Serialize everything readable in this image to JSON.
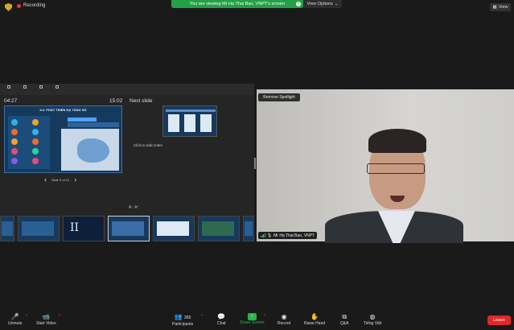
{
  "topbar": {
    "recording_label": "Recording",
    "viewing_banner": "You are viewing Mr Ha Thai Bao, VNPT's screen",
    "view_options_label": "View Options",
    "view_label": "View"
  },
  "presenter": {
    "tools": [
      "",
      "",
      "",
      "",
      ""
    ],
    "elapsed_time": "04:27",
    "slide_time": "15:02",
    "next_slide_label": "Next slide",
    "notes_placeholder": "Click to add notes",
    "slide_counter": "Slide 9 of 21",
    "slide_title": "II.2. PHÁT TRIỂN HẠ TẦNG SỐ",
    "thumb_numeral": "II",
    "thumbnails": [
      "",
      "",
      "",
      "",
      "",
      "",
      ""
    ]
  },
  "video": {
    "remove_spotlight": "Remove Spotlight",
    "participant_name": "Mr Ha Thai Bao, VNPT"
  },
  "toolbar": {
    "unmute": "Unmute",
    "start_video": "Start Video",
    "participants": "Participants",
    "participants_count": "265",
    "chat": "Chat",
    "share_screen": "Share Screen",
    "record": "Record",
    "raise_hand": "Raise Hand",
    "qa": "Q&A",
    "language": "Tiếng Việt",
    "leave": "Leave"
  },
  "colors": {
    "share_green": "#2bb34b",
    "leave_red": "#e02828",
    "banner_green": "#25a046"
  }
}
